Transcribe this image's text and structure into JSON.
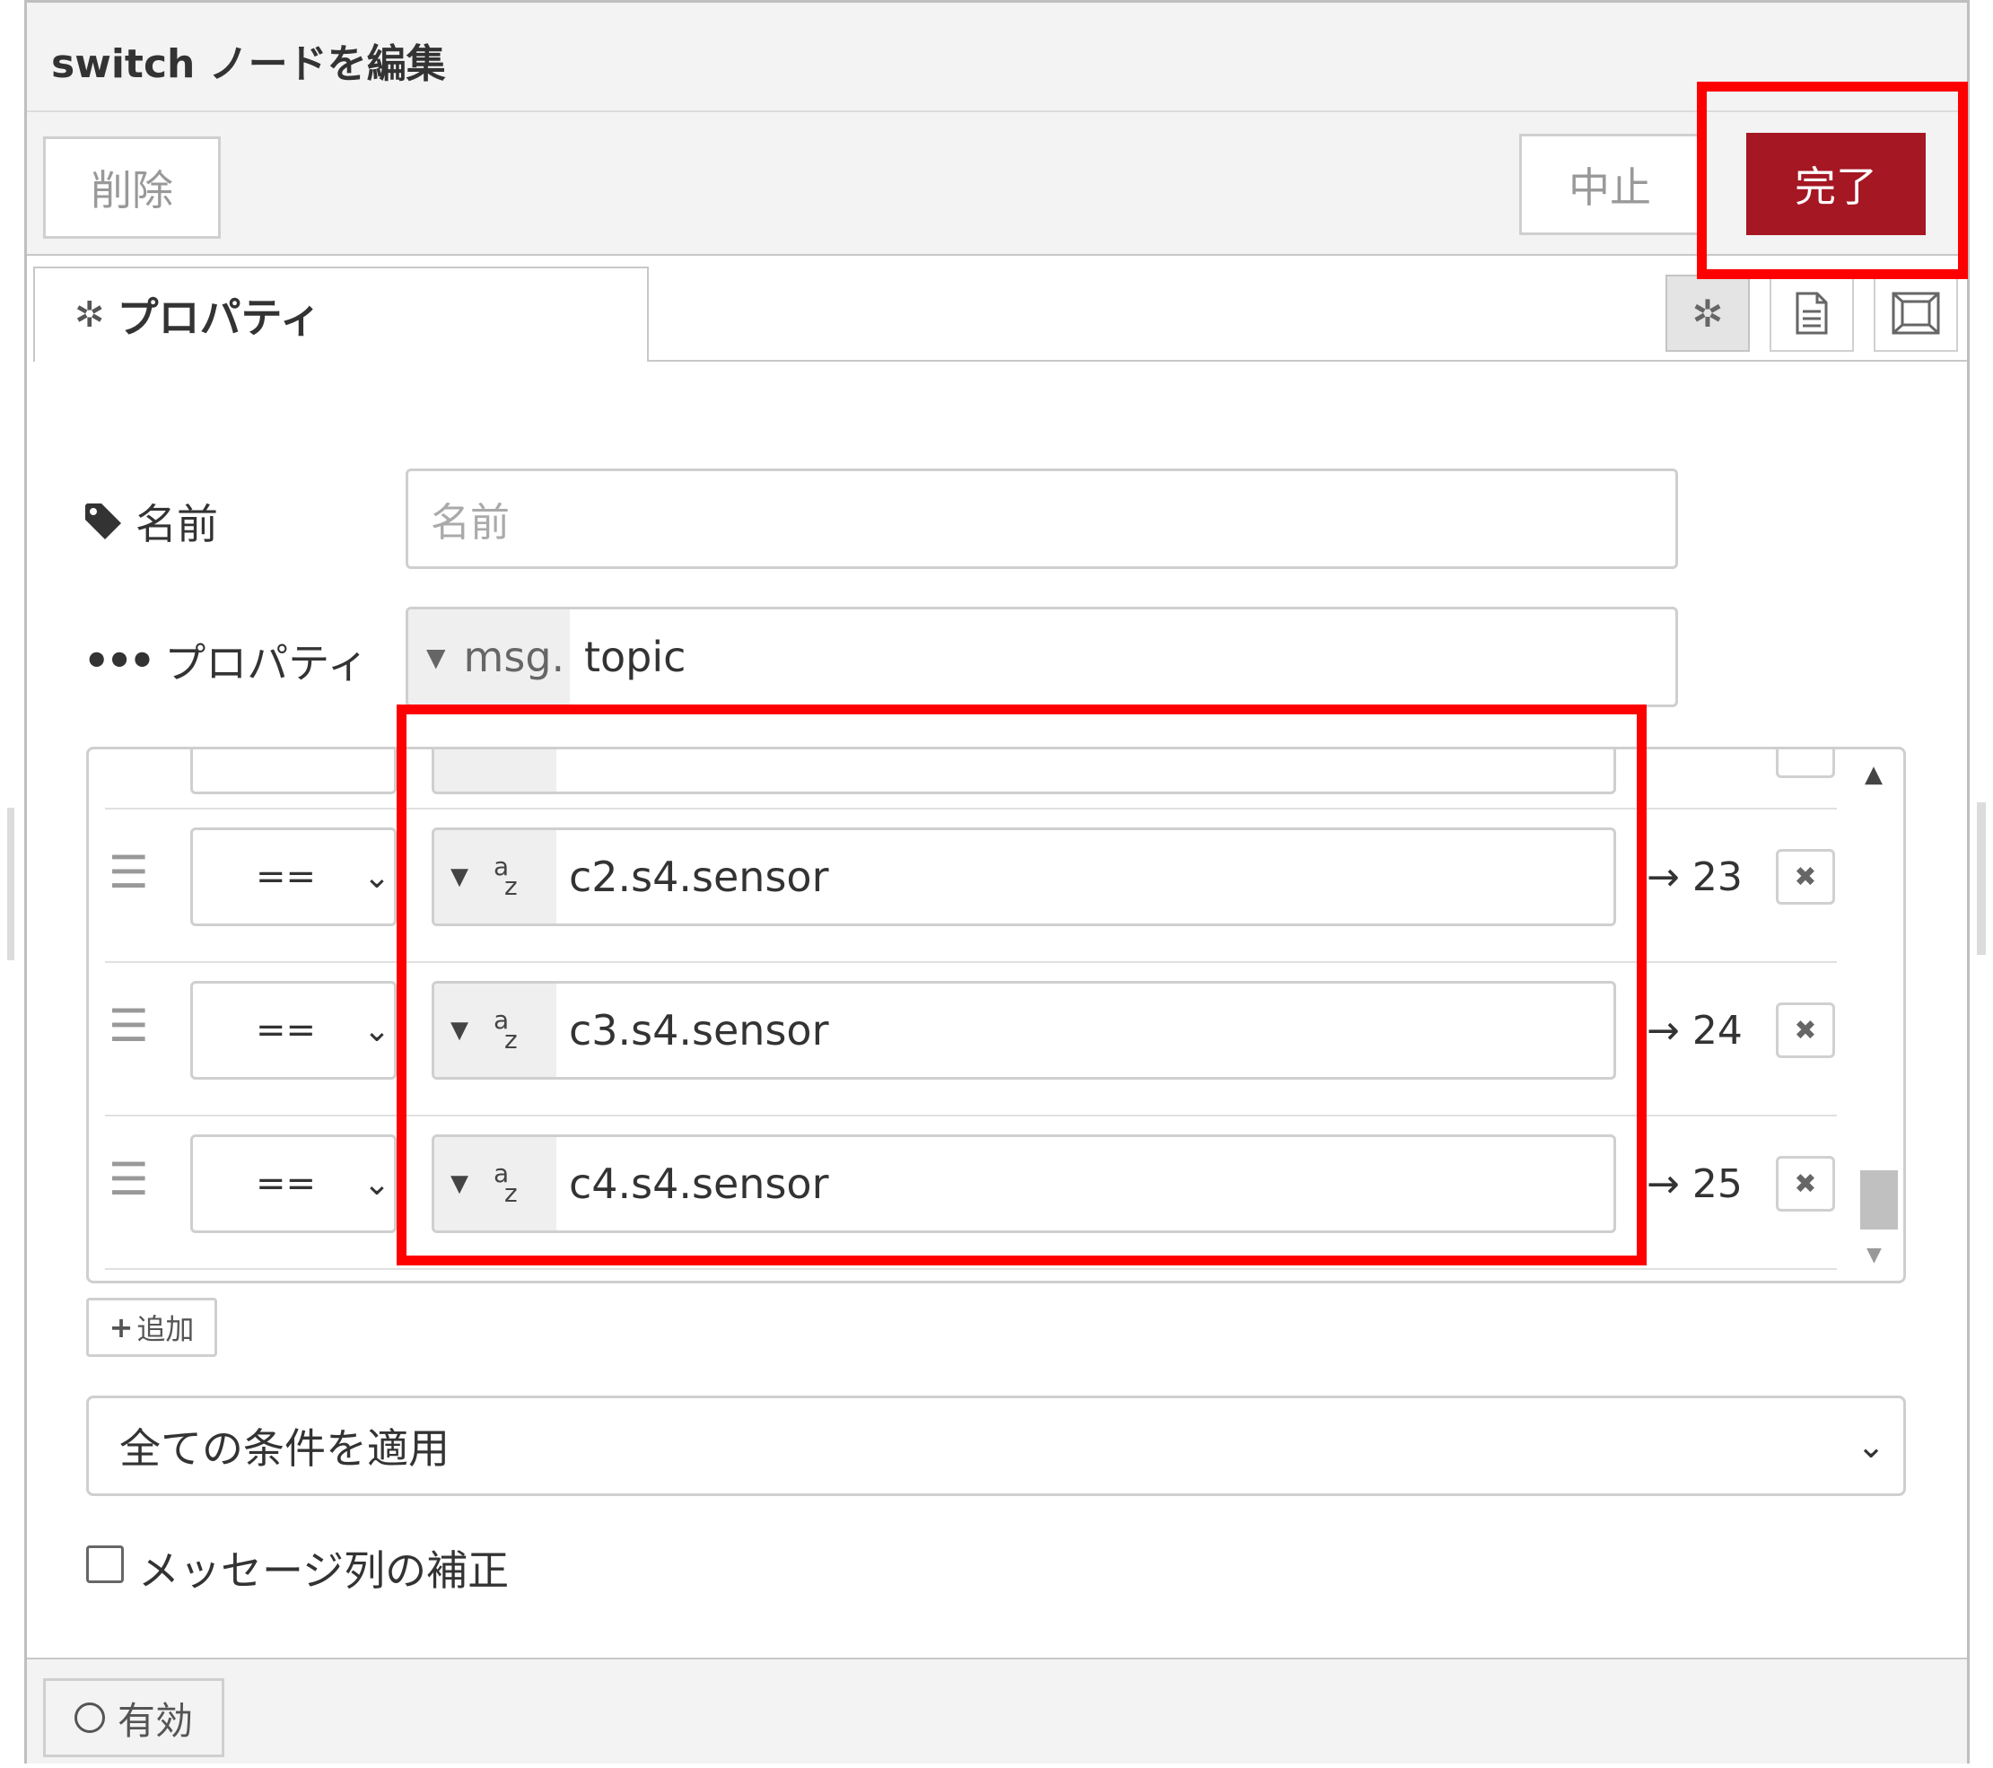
{
  "dialog": {
    "title": "switch ノードを編集"
  },
  "toolbar": {
    "delete_label": "削除",
    "cancel_label": "中止",
    "done_label": "完了",
    "done_color": "#a51723"
  },
  "tabs": {
    "properties_label": "プロパティ",
    "icons": [
      "gear-icon",
      "document-icon",
      "frame-icon"
    ]
  },
  "form": {
    "name_label": "名前",
    "name_placeholder": "名前",
    "property_label": "プロパティ",
    "property_prefix": "msg.",
    "property_value": "topic"
  },
  "rules": [
    {
      "operator": "==",
      "value_type": "string",
      "value": "c2.s4.sensor",
      "output": "→ 23"
    },
    {
      "operator": "==",
      "value_type": "string",
      "value": "c3.s4.sensor",
      "output": "→ 24"
    },
    {
      "operator": "==",
      "value_type": "string",
      "value": "c4.s4.sensor",
      "output": "→ 25"
    }
  ],
  "add_label": "追加",
  "check_all_option": "全ての条件を適用",
  "recreate_sequence_label": "メッセージ列の補正",
  "footer": {
    "enabled_label": "有効"
  },
  "highlight_color": "#ff0000"
}
